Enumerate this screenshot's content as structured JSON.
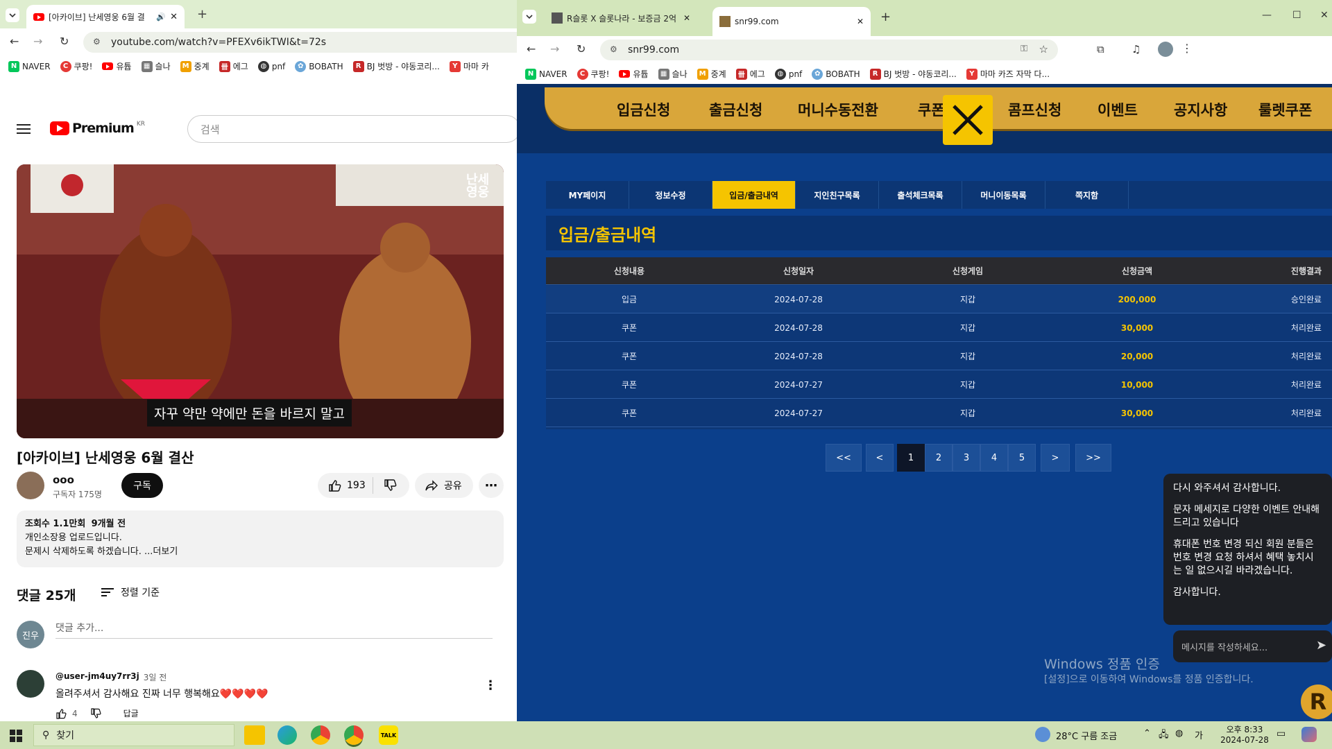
{
  "left_browser": {
    "tab_title": "[아카이브] 난세영웅 6월 결",
    "url": "youtube.com/watch?v=PFEXv6ikTWI&t=72s",
    "bookmarks": [
      "NAVER",
      "쿠팡!",
      "유튭",
      "슬나",
      "중계",
      "에그",
      "pnf",
      "BOBATH",
      "BJ 벗방 - 야동코리...",
      "마마 카"
    ]
  },
  "youtube": {
    "logo": "Premium",
    "region": "KR",
    "search_placeholder": "검색",
    "caption": "자꾸 약만 약에만 돈을 바르지 말고",
    "channel_mark": "난세영웅",
    "title": "[아카이브] 난세영웅 6월 결산",
    "channel_name": "ooo",
    "subscribers": "구독자 175명",
    "subscribe_label": "구독",
    "likes": "193",
    "share_label": "공유",
    "description": {
      "views": "조회수 1.1만회",
      "age": "9개월 전",
      "line1": "개인소장용 업로드입니다.",
      "line2": "문제시 삭제하도록 하겠습니다. ...더보기"
    },
    "comments_count": "댓글 25개",
    "sort_label": "정렬 기준",
    "avatar_text": "진우",
    "comment_placeholder": "댓글 추가...",
    "comment": {
      "user": "@user-jm4uy7rr3j",
      "time": "3일 전",
      "text": "올려주셔서 감사해요 진짜 너무 행복해요❤️❤️❤️❤️",
      "likes": "4",
      "reply_label": "답글"
    }
  },
  "right_browser": {
    "tabs": [
      "R슬롯 X 슬롯나라 - 보증금 2억",
      "snr99.com"
    ],
    "url": "snr99.com",
    "bookmarks": [
      "NAVER",
      "쿠팡!",
      "유튭",
      "슬나",
      "중계",
      "에그",
      "pnf",
      "BOBATH",
      "BJ 벗방 - 야동코리...",
      "마마 카즈 자막 다..."
    ]
  },
  "site": {
    "main_nav": [
      "입금신청",
      "출금신청",
      "머니수동전환",
      "쿠폰",
      "콤프신청",
      "이벤트",
      "공지사항",
      "룰렛쿠폰"
    ],
    "sub_tabs": [
      "MY페이지",
      "정보수정",
      "입금/출금내역",
      "지인친구목록",
      "출석체크목록",
      "머니이동목록",
      "쪽지함"
    ],
    "active_sub_tab": "입금/출금내역",
    "section_title": "입금/출금내역",
    "table_headers": [
      "신청내용",
      "신청일자",
      "신청게임",
      "신청금액",
      "진행결과"
    ],
    "rows": [
      {
        "type": "입금",
        "date": "2024-07-28",
        "game": "지갑",
        "amount": "200,000",
        "result": "승인완료"
      },
      {
        "type": "쿠폰",
        "date": "2024-07-28",
        "game": "지갑",
        "amount": "30,000",
        "result": "처리완료"
      },
      {
        "type": "쿠폰",
        "date": "2024-07-28",
        "game": "지갑",
        "amount": "20,000",
        "result": "처리완료"
      },
      {
        "type": "쿠폰",
        "date": "2024-07-27",
        "game": "지갑",
        "amount": "10,000",
        "result": "처리완료"
      },
      {
        "type": "쿠폰",
        "date": "2024-07-27",
        "game": "지갑",
        "amount": "30,000",
        "result": "처리완료"
      }
    ],
    "pagination": [
      "<<",
      "<",
      "1",
      "2",
      "3",
      "4",
      "5",
      ">",
      ">>"
    ],
    "current_page": "1",
    "chat": {
      "message1": "다시 와주셔서 감사합니다.",
      "message2": "문자 메세지로 다양한 이벤트 안내해드리고 있습니다",
      "message3": "휴대폰 번호 변경 되신 회원 분들은 번호 변경 요청 하셔서 혜택 놓치시는 일 없으시길 바라겠습니다.",
      "message4": "감사합니다.",
      "input_placeholder": "메시지를 작성하세요..."
    },
    "watermark_title": "Windows 정품 인증",
    "watermark_sub": "[설정]으로 이동하여 Windows를 정품 인증합니다."
  },
  "taskbar": {
    "search_label": "찾기",
    "weather": "28°C  구름 조금",
    "time": "오후 8:33",
    "date": "2024-07-28",
    "accent": "#f5c400"
  }
}
